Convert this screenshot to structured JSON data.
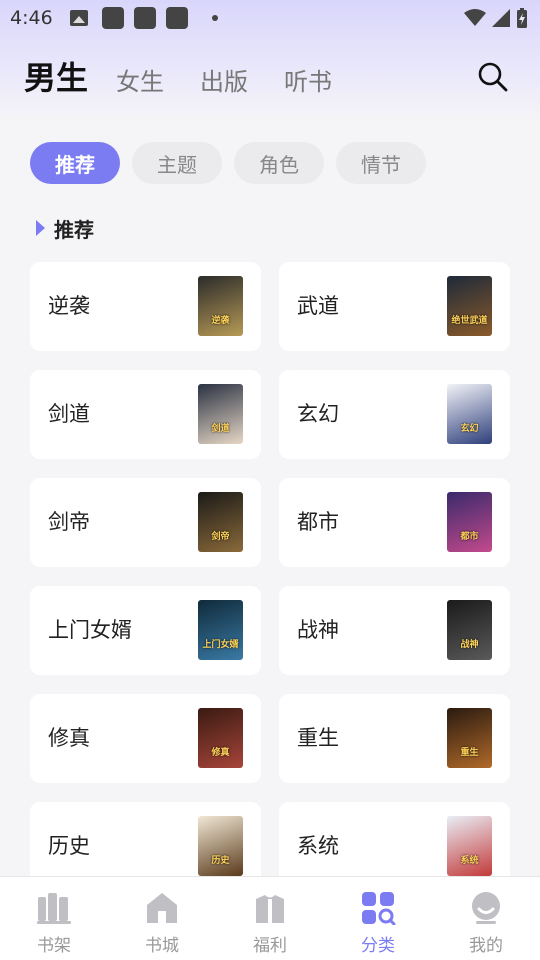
{
  "status_bar": {
    "time": "4:46"
  },
  "top_tabs": [
    {
      "label": "男生",
      "active": true
    },
    {
      "label": "女生",
      "active": false
    },
    {
      "label": "出版",
      "active": false
    },
    {
      "label": "听书",
      "active": false
    }
  ],
  "pills": [
    {
      "label": "推荐",
      "active": true
    },
    {
      "label": "主题",
      "active": false
    },
    {
      "label": "角色",
      "active": false
    },
    {
      "label": "情节",
      "active": false
    }
  ],
  "section_title": "推荐",
  "categories": [
    {
      "name": "逆袭",
      "cover_text": "逆袭",
      "cover_colors": [
        "#2b2b2b",
        "#b79a55"
      ]
    },
    {
      "name": "武道",
      "cover_text": "绝世武道",
      "cover_colors": [
        "#1e2a3a",
        "#8a5a2a"
      ]
    },
    {
      "name": "剑道",
      "cover_text": "剑道",
      "cover_colors": [
        "#2a3142",
        "#e7d8c6"
      ]
    },
    {
      "name": "玄幻",
      "cover_text": "玄幻",
      "cover_colors": [
        "#f2f3f8",
        "#2e3f7a"
      ]
    },
    {
      "name": "剑帝",
      "cover_text": "剑帝",
      "cover_colors": [
        "#1b1a18",
        "#8a6a3a"
      ]
    },
    {
      "name": "都市",
      "cover_text": "都市",
      "cover_colors": [
        "#3a2a6b",
        "#c34a8c"
      ]
    },
    {
      "name": "上门女婿",
      "cover_text": "上门女婿",
      "cover_colors": [
        "#102a3a",
        "#3a7aa5"
      ]
    },
    {
      "name": "战神",
      "cover_text": "战神",
      "cover_colors": [
        "#1a1a1a",
        "#5a5a5a"
      ]
    },
    {
      "name": "修真",
      "cover_text": "修真",
      "cover_colors": [
        "#3a1a12",
        "#a8453a"
      ]
    },
    {
      "name": "重生",
      "cover_text": "重生",
      "cover_colors": [
        "#2a1a10",
        "#b06a2a"
      ]
    },
    {
      "name": "历史",
      "cover_text": "历史",
      "cover_colors": [
        "#f1e8d6",
        "#5a3a1a"
      ]
    },
    {
      "name": "系统",
      "cover_text": "系统",
      "cover_colors": [
        "#e9eef6",
        "#c33a3a"
      ]
    }
  ],
  "bottom_nav": [
    {
      "label": "书架",
      "icon": "bookshelf-icon",
      "active": false
    },
    {
      "label": "书城",
      "icon": "bookstore-icon",
      "active": false
    },
    {
      "label": "福利",
      "icon": "gift-icon",
      "active": false
    },
    {
      "label": "分类",
      "icon": "category-icon",
      "active": true
    },
    {
      "label": "我的",
      "icon": "profile-icon",
      "active": false
    }
  ],
  "colors": {
    "accent": "#7c7cf2",
    "inactive": "#999999"
  }
}
